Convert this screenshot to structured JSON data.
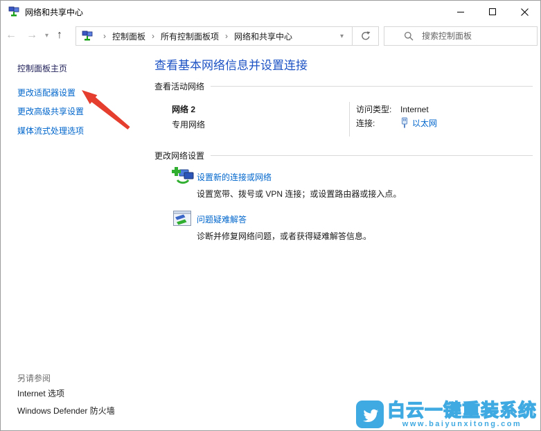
{
  "window": {
    "title": "网络和共享中心"
  },
  "navbar": {
    "breadcrumb": [
      "控制面板",
      "所有控制面板项",
      "网络和共享中心"
    ],
    "search_placeholder": "搜索控制面板"
  },
  "sidebar": {
    "home_label": "控制面板主页",
    "links": [
      "更改适配器设置",
      "更改高级共享设置",
      "媒体流式处理选项"
    ],
    "see_also_header": "另请参阅",
    "see_also_links": [
      "Internet 选项",
      "Windows Defender 防火墙"
    ]
  },
  "main": {
    "title": "查看基本网络信息并设置连接",
    "active_section": "查看活动网络",
    "change_section": "更改网络设置",
    "network": {
      "name": "网络 2",
      "profile": "专用网络",
      "access_label": "访问类型:",
      "access_value": "Internet",
      "connection_label": "连接:",
      "connection_value": "以太网"
    },
    "tasks": [
      {
        "title": "设置新的连接或网络",
        "desc": "设置宽带、拨号或 VPN 连接；或设置路由器或接入点。"
      },
      {
        "title": "问题疑难解答",
        "desc": "诊断并修复网络问题，或者获得疑难解答信息。"
      }
    ]
  },
  "watermark": {
    "title": "白云一键重装系统",
    "url": "www.baiyunxitong.com"
  },
  "colors": {
    "link": "#0066cc",
    "heading": "#1d53c4",
    "arrow": "#e53d2e",
    "watermark": "#3fa9e1"
  }
}
